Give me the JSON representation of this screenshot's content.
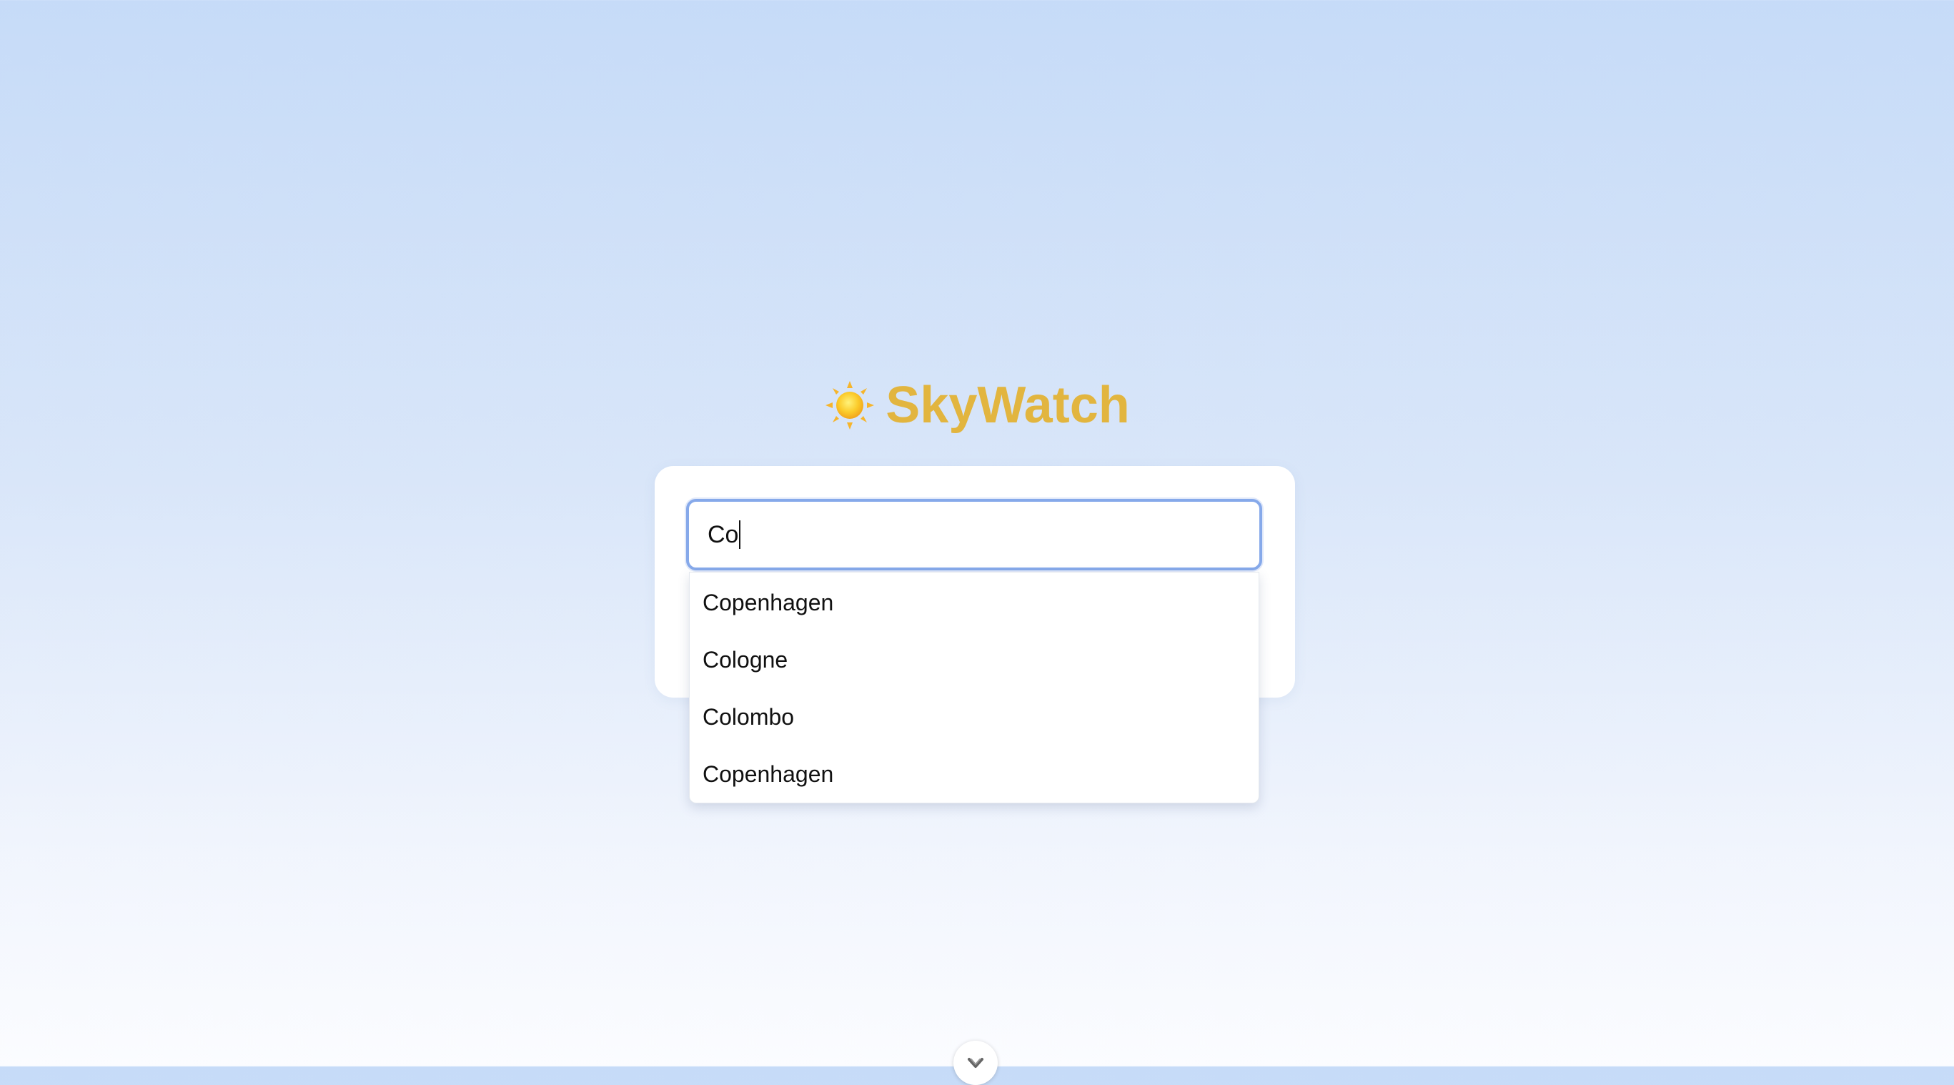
{
  "app": {
    "title": "SkyWatch",
    "logo_icon": "sun-icon",
    "brand_color": "#e2b53f"
  },
  "search": {
    "value": "Co",
    "focus_color": "#86a9ea"
  },
  "suggestions": [
    {
      "label": "Copenhagen"
    },
    {
      "label": "Cologne"
    },
    {
      "label": "Colombo"
    },
    {
      "label": "Copenhagen"
    }
  ],
  "footer": {
    "toggle_icon": "chevron-down-icon"
  }
}
